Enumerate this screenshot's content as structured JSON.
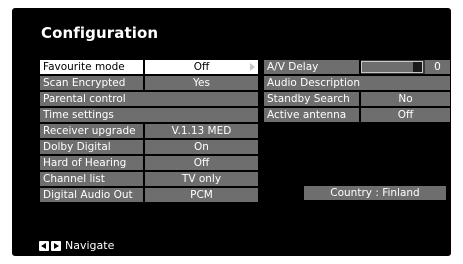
{
  "screen": {
    "title": "Configuration"
  },
  "left_menu": [
    {
      "label": "Favourite mode",
      "value": "Off",
      "selected": true,
      "has_value": true
    },
    {
      "label": "Scan Encrypted",
      "value": "Yes",
      "selected": false,
      "has_value": true
    },
    {
      "label": "Parental control",
      "value": "",
      "selected": false,
      "has_value": false
    },
    {
      "label": "Time settings",
      "value": "",
      "selected": false,
      "has_value": false
    },
    {
      "label": "Receiver upgrade",
      "value": "V.1.13 MED",
      "selected": false,
      "has_value": true
    },
    {
      "label": "Dolby Digital",
      "value": "On",
      "selected": false,
      "has_value": true
    },
    {
      "label": "Hard of Hearing",
      "value": "Off",
      "selected": false,
      "has_value": true
    },
    {
      "label": "Channel list",
      "value": "TV only",
      "selected": false,
      "has_value": true
    },
    {
      "label": "Digital Audio Out",
      "value": "PCM",
      "selected": false,
      "has_value": true
    }
  ],
  "right_menu": {
    "av_delay": {
      "label": "A/V Delay",
      "value": "0",
      "level": 0.85
    },
    "audio_description": {
      "label": "Audio Description"
    },
    "standby_search": {
      "label": "Standby Search",
      "value": "No"
    },
    "active_antenna": {
      "label": "Active antenna",
      "value": "Off"
    }
  },
  "country": "Country : Finland",
  "footer": {
    "navigate_label": "Navigate",
    "icons": [
      "left-arrow-key-icon",
      "right-arrow-key-icon"
    ]
  },
  "colors": {
    "background": "#000000",
    "cell": "#6e6e6e",
    "selected_cell": "#ffffff",
    "text": "#ffffff"
  }
}
